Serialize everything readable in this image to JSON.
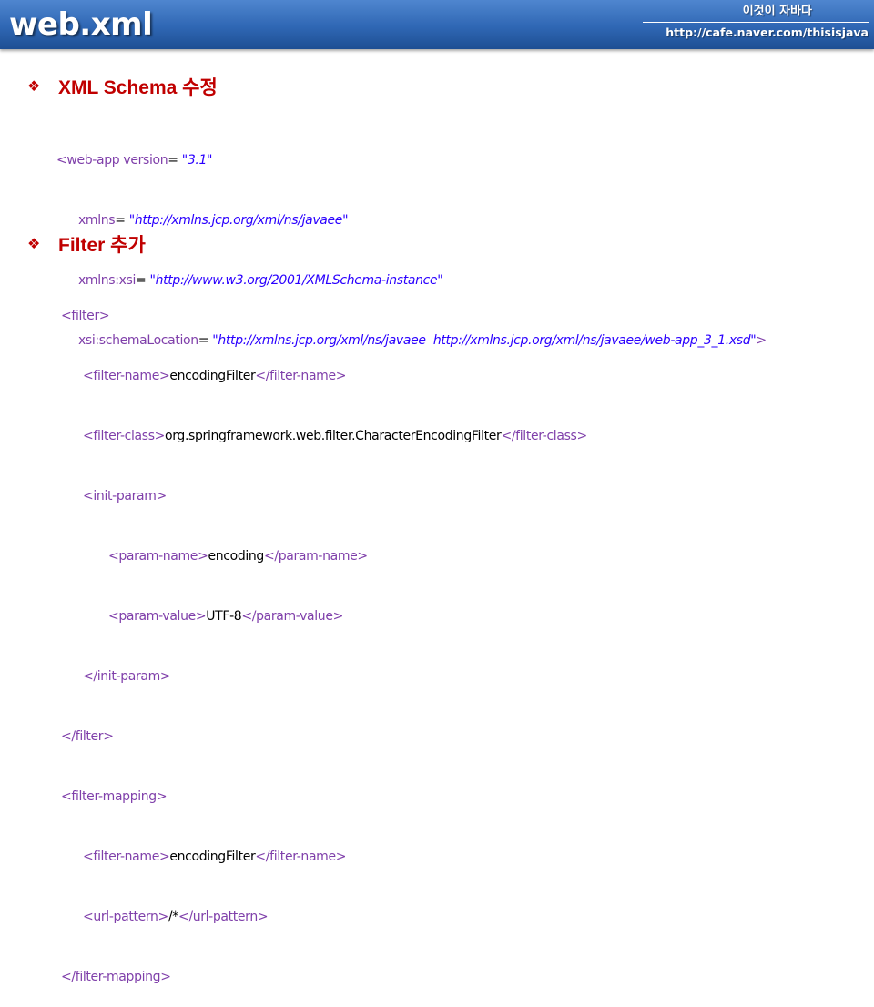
{
  "header": {
    "title": "web.xml",
    "brand_name": "이것이 자바다",
    "brand_url": "http://cafe.naver.com/thisisjava"
  },
  "sections": [
    {
      "bullet": "❖",
      "heading": "XML Schema 수정",
      "code": [
        {
          "tag_open": "<web-app",
          "attr": "version",
          "value": "\"3.1\""
        },
        {
          "attr": "xmlns",
          "value": "\"http://xmlns.jcp.org/xml/ns/javaee\""
        },
        {
          "attr": "xmlns:xsi",
          "value": "\"http://www.w3.org/2001/XMLSchema-instance\""
        },
        {
          "attr": "xsi:schemaLocation",
          "value": "\"http://xmlns.jcp.org/xml/ns/javaee  http://xmlns.jcp.org/xml/ns/javaee/web-app_3_1.xsd\"",
          "tag_close": ">"
        }
      ]
    },
    {
      "bullet": "❖",
      "heading": "Filter 추가",
      "code": [
        {
          "open": "<filter>"
        },
        {
          "open": "<filter-name>",
          "text": "encodingFilter",
          "close": "</filter-name>"
        },
        {
          "open": "<filter-class>",
          "text": "org.springframework.web.filter.CharacterEncodingFilter",
          "close": "</filter-class>"
        },
        {
          "open": "<init-param>"
        },
        {
          "open": "<param-name>",
          "text": "encoding",
          "close": "</param-name>"
        },
        {
          "open": "<param-value>",
          "text": "UTF-8",
          "close": "</param-value>"
        },
        {
          "open": "</init-param>"
        },
        {
          "open": "</filter>"
        },
        {
          "open": "<filter-mapping>"
        },
        {
          "open": "<filter-name>",
          "text": "encodingFilter",
          "close": "</filter-name>"
        },
        {
          "open": "<url-pattern>",
          "text": "/*",
          "close": "</url-pattern>"
        },
        {
          "open": "</filter-mapping>"
        }
      ]
    }
  ]
}
